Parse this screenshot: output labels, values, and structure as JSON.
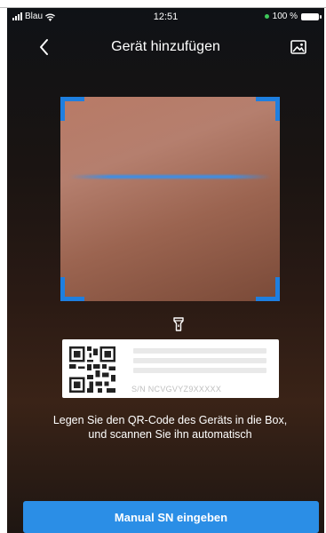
{
  "status_bar": {
    "carrier": "Blau",
    "time": "12:51",
    "battery": "100 %",
    "icons": [
      "signal-icon",
      "wifi-icon",
      "battery-icon"
    ]
  },
  "navbar": {
    "title": "Gerät hinzufügen",
    "back_icon": "chevron-left-icon",
    "gallery_icon": "image-icon"
  },
  "scanner": {
    "flashlight_icon": "flashlight-icon",
    "frame_color": "#1e7fe0",
    "scanline_color": "#3b8fe8"
  },
  "example_label": {
    "serial_prefix": "S/N",
    "serial_number": "NCVGVYZ9XXXXX"
  },
  "instructions": "Legen Sie den QR-Code des Geräts in die Box, und scannen Sie ihn automatisch",
  "manual_button": {
    "label": "Manual SN eingeben",
    "color": "#2b8ee6"
  }
}
